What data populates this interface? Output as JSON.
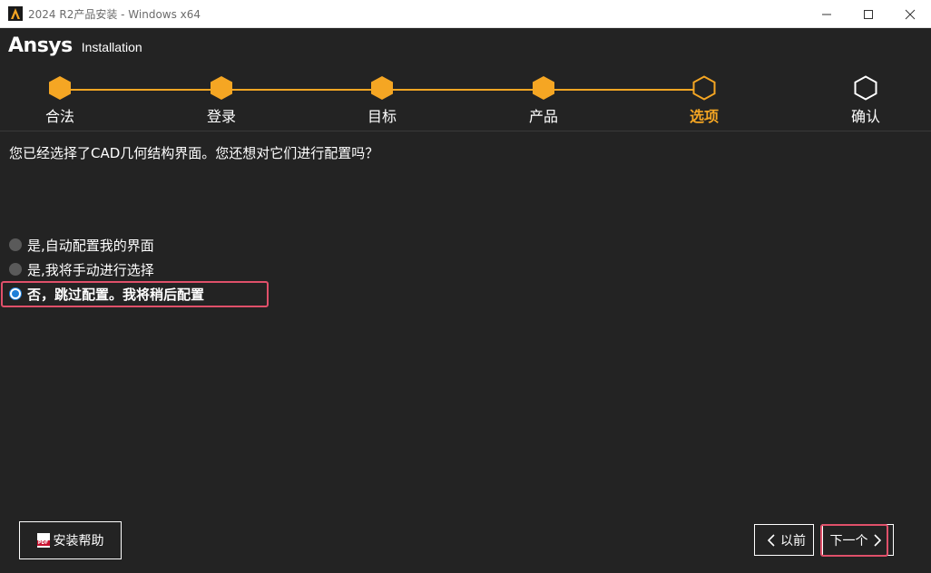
{
  "window": {
    "title": "2024 R2产品安装 - Windows x64",
    "icon": "ansys-app-icon"
  },
  "header": {
    "logo": "Ansys",
    "subtitle": "Installation"
  },
  "steps": [
    {
      "label": "合法",
      "state": "done"
    },
    {
      "label": "登录",
      "state": "done"
    },
    {
      "label": "目标",
      "state": "done"
    },
    {
      "label": "产品",
      "state": "done"
    },
    {
      "label": "选项",
      "state": "current"
    },
    {
      "label": "确认",
      "state": "pending"
    }
  ],
  "colors": {
    "accent": "#f5a623",
    "background": "#232323",
    "highlight": "#e0506a",
    "radio_selected": "#1e7fd8"
  },
  "content": {
    "question": "您已经选择了CAD几何结构界面。您还想对它们进行配置吗？",
    "options": [
      {
        "label": "是,自动配置我的界面",
        "selected": false
      },
      {
        "label": "是,我将手动进行选择",
        "selected": false
      },
      {
        "label": "否，跳过配置。我将稍后配置",
        "selected": true
      }
    ]
  },
  "footer": {
    "help_label": "安装帮助",
    "help_icon": "pdf-icon",
    "prev_label": "以前",
    "next_label": "下一个"
  }
}
